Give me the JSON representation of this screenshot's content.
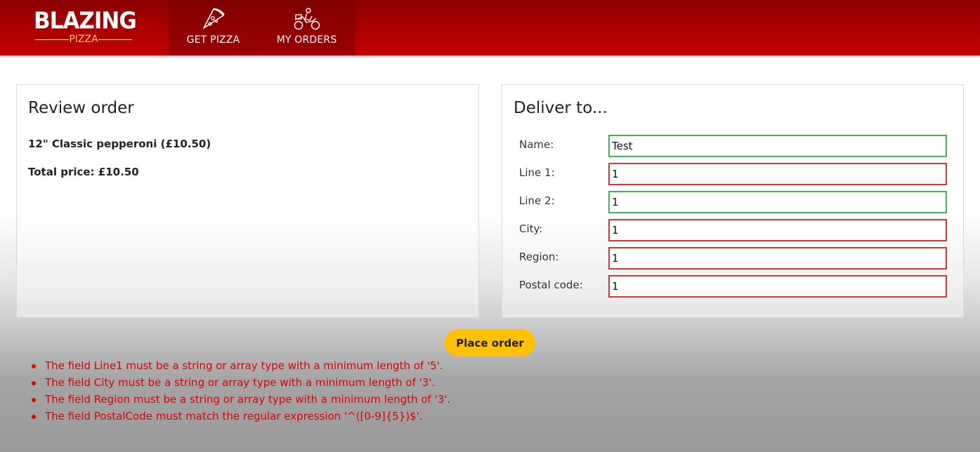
{
  "header": {
    "logo_main": "BLAZING",
    "logo_sub": "PIZZA",
    "nav": [
      {
        "label": "GET PIZZA",
        "icon": "pizza-slice-icon"
      },
      {
        "label": "MY ORDERS",
        "icon": "delivery-scooter-icon"
      }
    ]
  },
  "review": {
    "title": "Review order",
    "item": "12\" Classic pepperoni (£10.50)",
    "total": "Total price: £10.50"
  },
  "delivery": {
    "title": "Deliver to...",
    "fields": [
      {
        "label": "Name:",
        "value": "Test",
        "valid": true
      },
      {
        "label": "Line 1:",
        "value": "1",
        "valid": false
      },
      {
        "label": "Line 2:",
        "value": "1",
        "valid": true
      },
      {
        "label": "City:",
        "value": "1",
        "valid": false
      },
      {
        "label": "Region:",
        "value": "1",
        "valid": false
      },
      {
        "label": "Postal code:",
        "value": "1",
        "valid": false
      }
    ]
  },
  "place_order_label": "Place order",
  "errors": [
    "The field Line1 must be a string or array type with a minimum length of '5'.",
    "The field City must be a string or array type with a minimum length of '3'.",
    "The field Region must be a string or array type with a minimum length of '3'.",
    "The field PostalCode must match the regular expression '^([0-9]{5})$'."
  ],
  "colors": {
    "header_red": "#c30000",
    "accent_yellow": "#ffc107",
    "valid_border": "#4caa5e",
    "invalid_border": "#c93a3a",
    "error_text": "#e00000"
  }
}
